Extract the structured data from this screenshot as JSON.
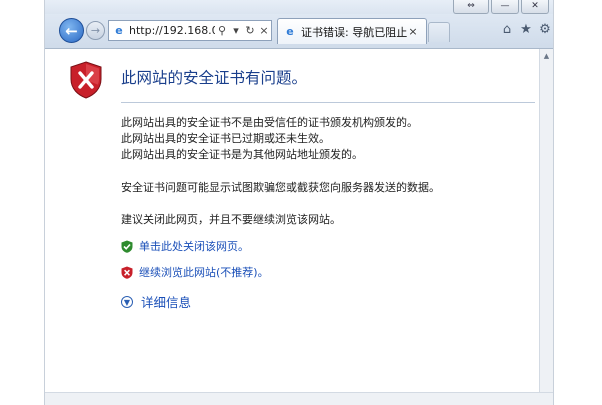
{
  "window": {
    "controls": {
      "restore_icon": "⇔",
      "minimize_icon": "—",
      "close_icon": "✕"
    }
  },
  "toolbar": {
    "back_icon": "←",
    "forward_icon": "→",
    "address": {
      "favicon_icon": "e",
      "url": "http://192.168.0.…",
      "search_icon": "⚲",
      "dropdown_icon": "▾",
      "refresh_icon": "↻",
      "stop_icon": "×"
    },
    "tab": {
      "favicon_icon": "e",
      "title": "证书错误: 导航已阻止",
      "close_icon": "×"
    },
    "home_icon": "⌂",
    "favorites_icon": "★",
    "tools_icon": "⚙"
  },
  "page": {
    "title": "此网站的安全证书有问题。",
    "reasons": [
      "此网站出具的安全证书不是由受信任的证书颁发机构颁发的。",
      "此网站出具的安全证书已过期或还未生效。",
      "此网站出具的安全证书是为其他网站地址颁发的。"
    ],
    "warning": "安全证书问题可能显示试图欺骗您或截获您向服务器发送的数据。",
    "recommendation": "建议关闭此网页，并且不要继续浏览该网站。",
    "close_link": "单击此处关闭该网页。",
    "continue_link": "继续浏览此网站(不推荐)。",
    "more_info": "详细信息"
  },
  "colors": {
    "title_blue": "#1a3f8c",
    "link_blue": "#1a4fb8",
    "shield_red": "#c8202a",
    "check_green": "#2e8b2e"
  }
}
